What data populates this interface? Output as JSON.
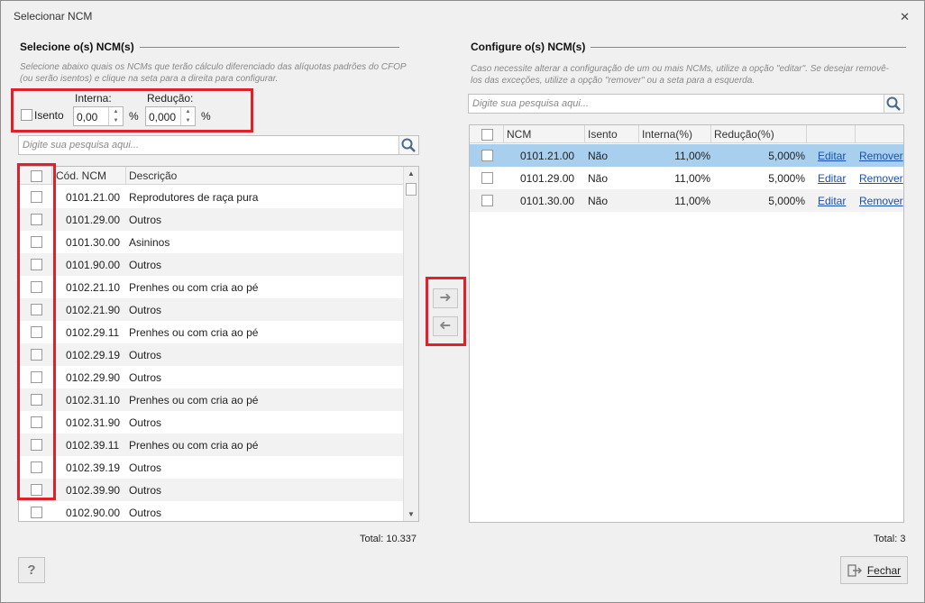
{
  "window": {
    "title": "Selecionar NCM"
  },
  "left": {
    "heading": "Selecione o(s) NCM(s)",
    "hint": "Selecione abaixo quais os NCMs que terão cálculo diferenciado das alíquotas padrões do CFOP (ou serão isentos) e clique na seta para a direita para configurar.",
    "isento_label": "Isento",
    "interna_label": "Interna:",
    "interna_value": "0,00",
    "reducao_label": "Redução:",
    "reducao_value": "0,000",
    "pct": "%",
    "search_placeholder": "Digite sua pesquisa aqui...",
    "columns": [
      "Cód. NCM",
      "Descrição"
    ],
    "rows": [
      {
        "code": "0101.21.00",
        "desc": "Reprodutores de raça pura"
      },
      {
        "code": "0101.29.00",
        "desc": "Outros"
      },
      {
        "code": "0101.30.00",
        "desc": "Asininos"
      },
      {
        "code": "0101.90.00",
        "desc": "Outros"
      },
      {
        "code": "0102.21.10",
        "desc": "Prenhes ou com cria ao pé"
      },
      {
        "code": "0102.21.90",
        "desc": "Outros"
      },
      {
        "code": "0102.29.11",
        "desc": "Prenhes ou com cria ao pé"
      },
      {
        "code": "0102.29.19",
        "desc": "Outros"
      },
      {
        "code": "0102.29.90",
        "desc": "Outros"
      },
      {
        "code": "0102.31.10",
        "desc": "Prenhes ou com cria ao pé"
      },
      {
        "code": "0102.31.90",
        "desc": "Outros"
      },
      {
        "code": "0102.39.11",
        "desc": "Prenhes ou com cria ao pé"
      },
      {
        "code": "0102.39.19",
        "desc": "Outros"
      },
      {
        "code": "0102.39.90",
        "desc": "Outros"
      },
      {
        "code": "0102.90.00",
        "desc": "Outros"
      }
    ],
    "total": "Total: 10.337"
  },
  "right": {
    "heading": "Configure o(s) NCM(s)",
    "hint": "Caso necessite alterar a configuração de um ou mais NCMs, utilize a opção \"editar\". Se desejar removê-los das exceções, utilize a opção \"remover\" ou a seta para a esquerda.",
    "search_placeholder": "Digite sua pesquisa aqui...",
    "columns": [
      "NCM",
      "Isento",
      "Interna(%)",
      "Redução(%)"
    ],
    "rows": [
      {
        "ncm": "0101.21.00",
        "isento": "Não",
        "interna": "11,00%",
        "reducao": "5,000%",
        "edit": "Editar",
        "remove": "Remover"
      },
      {
        "ncm": "0101.29.00",
        "isento": "Não",
        "interna": "11,00%",
        "reducao": "5,000%",
        "edit": "Editar",
        "remove": "Remover"
      },
      {
        "ncm": "0101.30.00",
        "isento": "Não",
        "interna": "11,00%",
        "reducao": "5,000%",
        "edit": "Editar",
        "remove": "Remover"
      }
    ],
    "total": "Total: 3"
  },
  "buttons": {
    "help": "?",
    "close": "Fechar"
  },
  "colors": {
    "highlight": "#e0202a",
    "selected_row": "#a8d0ee",
    "link": "#1a4fb3"
  }
}
